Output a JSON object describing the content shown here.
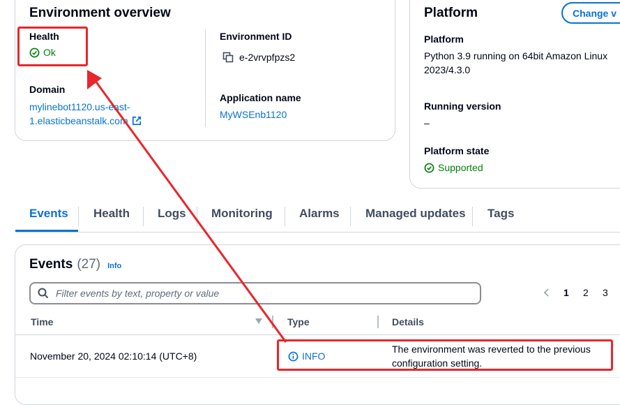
{
  "overview": {
    "title": "Environment overview",
    "health_label": "Health",
    "health_value": "Ok",
    "env_id_label": "Environment ID",
    "env_id_value": "e-2vrvpfpzs2",
    "domain_label": "Domain",
    "domain_line1": "mylinebot1120.us-east-",
    "domain_line2": "1.elasticbeanstalk.com",
    "app_name_label": "Application name",
    "app_name_value": "MyWSEnb1120"
  },
  "platform": {
    "title": "Platform",
    "change_button": "Change v",
    "platform_label": "Platform",
    "platform_line1": "Python 3.9 running on 64bit Amazon Linux",
    "platform_line2": "2023/4.3.0",
    "running_label": "Running version",
    "running_value": "–",
    "state_label": "Platform state",
    "state_value": "Supported"
  },
  "tabs": [
    {
      "label": "Events",
      "active": true
    },
    {
      "label": "Health"
    },
    {
      "label": "Logs"
    },
    {
      "label": "Monitoring"
    },
    {
      "label": "Alarms"
    },
    {
      "label": "Managed updates"
    },
    {
      "label": "Tags"
    }
  ],
  "events": {
    "title": "Events",
    "count": "(27)",
    "info_link": "Info",
    "search_placeholder": "Filter events by text, property or value",
    "pages": [
      "1",
      "2",
      "3"
    ],
    "columns": [
      "Time",
      "Type",
      "Details"
    ],
    "rows": [
      {
        "time": "November 20, 2024 02:10:14 (UTC+8)",
        "type": "INFO",
        "details_line1": "The environment was reverted to the previous",
        "details_line2": "configuration setting."
      }
    ]
  },
  "colors": {
    "accent": "#0972d3",
    "success": "#037f0c",
    "annotation": "#e8262b"
  }
}
